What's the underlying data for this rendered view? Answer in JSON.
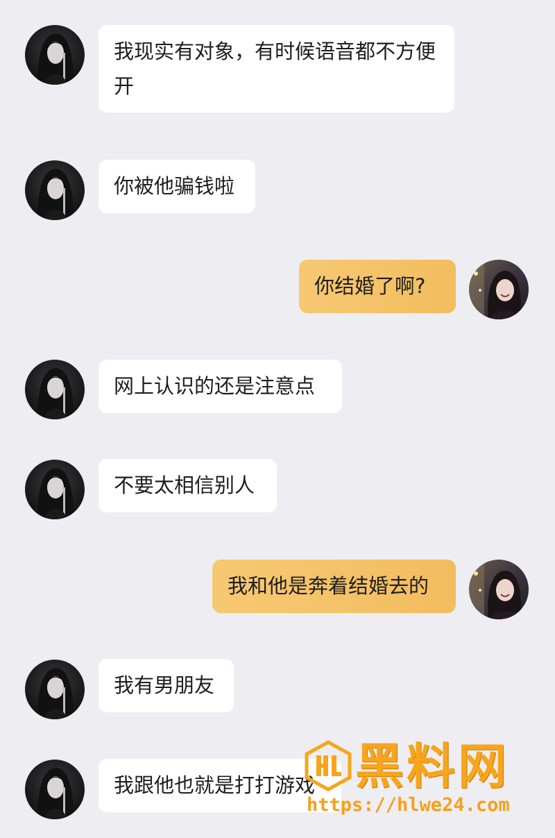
{
  "messages": [
    {
      "side": "in",
      "text": "我现实有对象，有时候语音都不方便开"
    },
    {
      "side": "in",
      "text": "你被他骗钱啦"
    },
    {
      "side": "out",
      "text": "你结婚了啊?"
    },
    {
      "side": "in",
      "text": "网上认识的还是注意点"
    },
    {
      "side": "in",
      "text": "不要太相信别人"
    },
    {
      "side": "out",
      "text": "我和他是奔着结婚去的"
    },
    {
      "side": "in",
      "text": "我有男朋友"
    },
    {
      "side": "in",
      "text": "我跟他也就是打打游戏"
    }
  ],
  "watermark": {
    "title": "黑料网",
    "url": "https://hlwe24.com"
  },
  "colors": {
    "background": "#eeeef2",
    "incoming_bubble": "#ffffff",
    "outgoing_bubble": "#f6c36b",
    "watermark": "#f6a51c"
  },
  "icons": {
    "contact_avatar": "dark-haired-girl-avatar",
    "self_avatar": "smiling-girl-photo-avatar",
    "watermark_logo": "hl-logo-icon"
  }
}
